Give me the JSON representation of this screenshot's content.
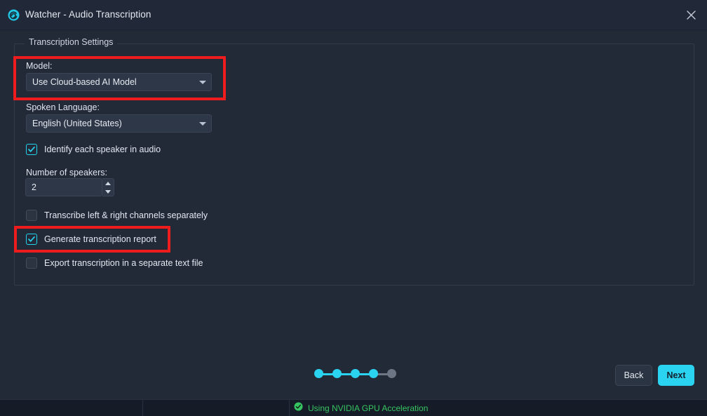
{
  "window": {
    "title": "Watcher - Audio Transcription",
    "app_icon": "spiral-logo-icon",
    "close_label": "×",
    "accent_color": "#2ad3f0",
    "background_color": "#222a38"
  },
  "group": {
    "legend": "Transcription Settings"
  },
  "fields": {
    "model_label": "Model:",
    "model_value": "Use Cloud-based AI Model",
    "language_label": "Spoken Language:",
    "language_value": "English (United States)",
    "speakers_label": "Number of speakers:",
    "speakers_value": "2"
  },
  "checkboxes": [
    {
      "label": "Identify each speaker in audio",
      "checked": true
    },
    {
      "label": "Transcribe left & right channels separately",
      "checked": false
    },
    {
      "label": "Generate transcription report",
      "checked": true
    },
    {
      "label": "Export transcription in a separate text file",
      "checked": false
    }
  ],
  "highlights": [
    {
      "target": "model-field",
      "color": "#ee1c1c"
    },
    {
      "target": "generate-transcription-report-checkbox",
      "color": "#ee1c1c"
    }
  ],
  "wizard": {
    "total_steps": 5,
    "current_step": 4,
    "completed_color": "#2ad3f0",
    "pending_color": "#6d7684"
  },
  "buttons": {
    "back": "Back",
    "next": "Next"
  },
  "statusbar": {
    "gpu_icon": "check-circle-icon",
    "gpu_text": "Using NVIDIA GPU Acceleration",
    "gpu_color": "#36c463"
  }
}
